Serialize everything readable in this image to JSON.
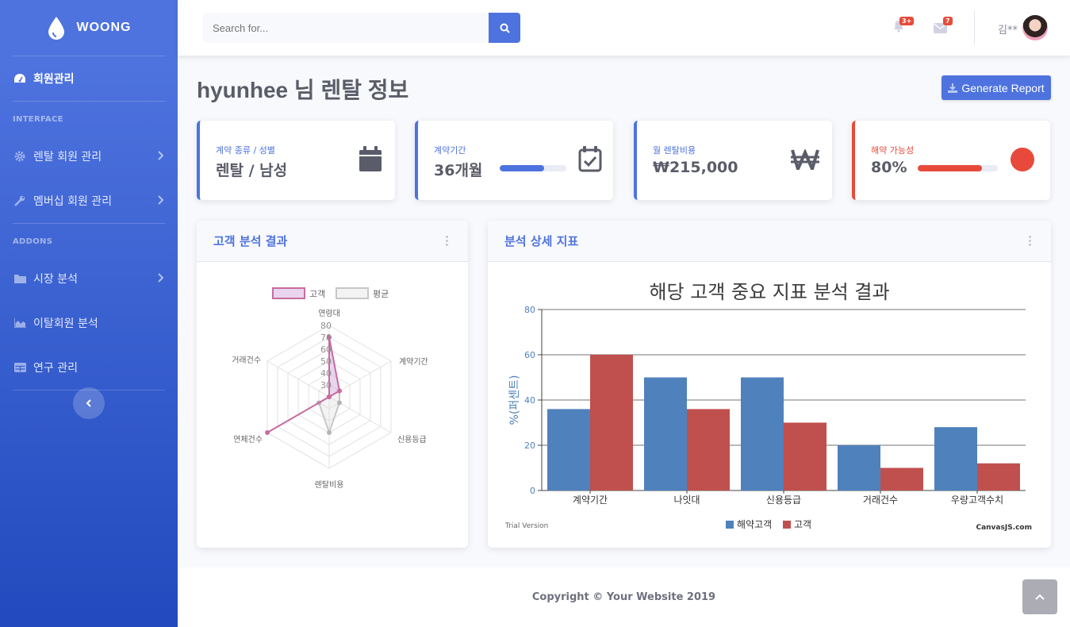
{
  "brand": {
    "name": "WOONG"
  },
  "sidebar": {
    "items": [
      {
        "label": "회원관리",
        "icon": "tachometer-icon"
      },
      {
        "label": "렌탈 회원 관리",
        "icon": "cog-icon"
      },
      {
        "label": "멤버십 회원 관리",
        "icon": "wrench-icon"
      },
      {
        "label": "시장 분석",
        "icon": "folder-icon"
      },
      {
        "label": "이탈회원 분석",
        "icon": "area-chart-icon"
      },
      {
        "label": "연구 관리",
        "icon": "table-icon"
      }
    ],
    "headings": {
      "interface": "INTERFACE",
      "addons": "ADDONS"
    }
  },
  "topbar": {
    "search_placeholder": "Search for...",
    "alerts_badge": "3+",
    "messages_badge": "7",
    "username": "김**"
  },
  "page": {
    "title": "hyunhee 님 렌탈 정보",
    "generate_button": "Generate Report"
  },
  "stats": [
    {
      "label": "계약 종류 / 성별",
      "value": "렌탈 / 남성"
    },
    {
      "label": "계약기간",
      "value": "36개월",
      "progress": 0.67
    },
    {
      "label": "월 렌탈비용",
      "value": "₩215,000"
    },
    {
      "label": "해약 가능성",
      "value": "80%",
      "progress": 0.8
    }
  ],
  "colors": {
    "primary": "#4e73df",
    "danger": "#e74a3b",
    "bar_blue": "#4f81bc",
    "bar_red": "#c0504e"
  },
  "radar_panel": {
    "title": "고객 분석 결과"
  },
  "bar_panel": {
    "title": "분석 상세 지표",
    "trial": "Trial Version",
    "credit": "CanvasJS.com"
  },
  "chart_data": [
    {
      "type": "radar",
      "categories": [
        "연령대",
        "계약기간",
        "신용등급",
        "렌탈비용",
        "연체건수",
        "거래건수"
      ],
      "series": [
        {
          "name": "고객",
          "values": [
            70,
            30,
            10,
            10,
            80,
            0
          ]
        },
        {
          "name": "평균",
          "values": [
            10,
            30,
            30,
            50,
            30,
            20
          ]
        }
      ],
      "ticks": [
        "30",
        "40",
        "50",
        "60",
        "70",
        "80"
      ],
      "rlim": [
        20,
        80
      ]
    },
    {
      "type": "bar",
      "title": "해당 고객 중요 지표 분석 결과",
      "ylabel": "%(퍼센트)",
      "categories": [
        "계약기간",
        "나잇대",
        "신용등급",
        "거래건수",
        "우량고객수치"
      ],
      "series": [
        {
          "name": "해약고객",
          "values": [
            36,
            50,
            50,
            20,
            28
          ]
        },
        {
          "name": "고객",
          "values": [
            60,
            36,
            30,
            10,
            12
          ]
        }
      ],
      "yticks": [
        0,
        20,
        40,
        60,
        80
      ],
      "ylim": [
        0,
        80
      ],
      "legend": "bottom"
    }
  ],
  "footer": {
    "text": "Copyright © Your Website 2019"
  }
}
